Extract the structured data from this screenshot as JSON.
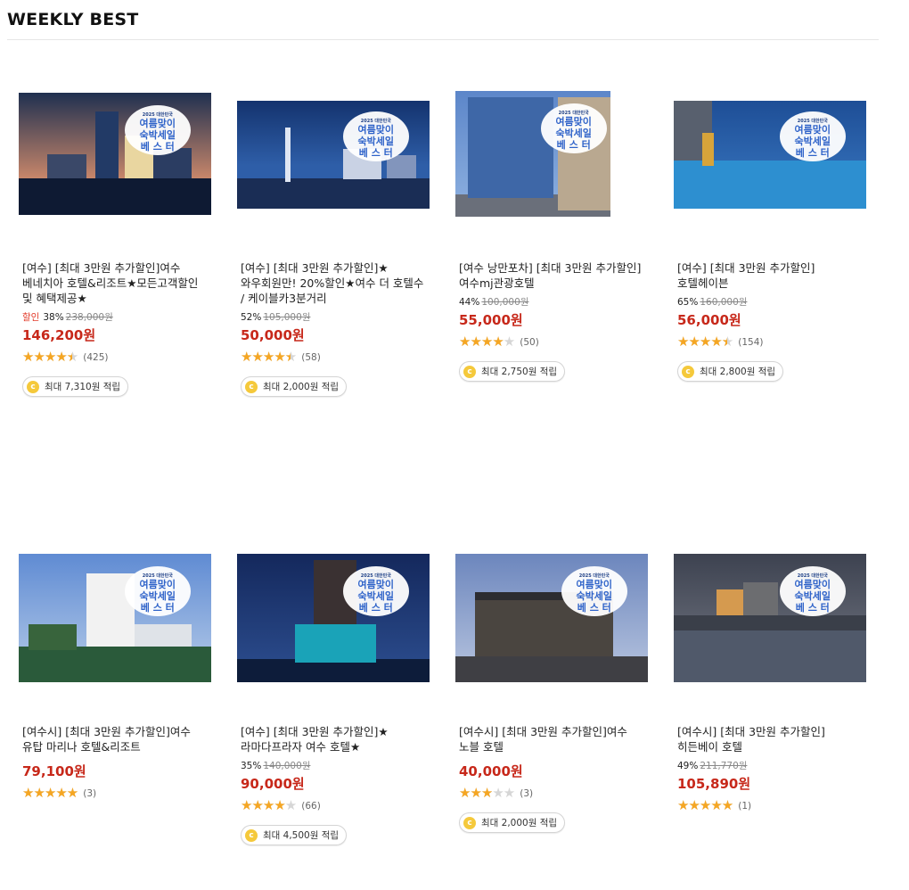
{
  "section": {
    "title": "WEEKLY BEST"
  },
  "badge": {
    "year": "2025 대한민국",
    "line1": "여름맞이",
    "line2": "숙박세일",
    "line3": "베 스 터"
  },
  "points_icon": "coin-icon",
  "colors": {
    "sale": "#e23c2b",
    "price": "#c7281a",
    "star": "#f5a623",
    "badge_text": "#2f63c9"
  },
  "products": [
    {
      "title": "[여수] [최대 3만원 추가할인]여수 베네치아 호텔&리조트★모든고객할인 및 혜택제공★",
      "sale_label": "할인",
      "discount": "38%",
      "original_price": "238,000원",
      "price": "146,200원",
      "rating": 4.5,
      "review_count": "(425)",
      "points": "최대 7,310원 적립"
    },
    {
      "title": "[여수] [최대 3만원 추가할인]★와우회원만! 20%할인★여수 더 호텔수 / 케이블카3분거리",
      "sale_label": "",
      "discount": "52%",
      "original_price": "105,000원",
      "price": "50,000원",
      "rating": 4.5,
      "review_count": "(58)",
      "points": "최대 2,000원 적립"
    },
    {
      "title": "[여수 낭만포차] [최대 3만원 추가할인]여수mj관광호텔",
      "sale_label": "",
      "discount": "44%",
      "original_price": "100,000원",
      "price": "55,000원",
      "rating": 4.0,
      "review_count": "(50)",
      "points": "최대 2,750원 적립"
    },
    {
      "title": "[여수] [최대 3만원 추가할인]호텔헤이븐",
      "sale_label": "",
      "discount": "65%",
      "original_price": "160,000원",
      "price": "56,000원",
      "rating": 4.5,
      "review_count": "(154)",
      "points": "최대 2,800원 적립"
    },
    {
      "title": "[여수시] [최대 3만원 추가할인]여수 유탑 마리나 호텔&리조트",
      "sale_label": "",
      "discount": "",
      "original_price": "",
      "price": "79,100원",
      "rating": 5.0,
      "review_count": "(3)",
      "points": ""
    },
    {
      "title": "[여수] [최대 3만원 추가할인]★라마다프라자 여수 호텔★",
      "sale_label": "",
      "discount": "35%",
      "original_price": "140,000원",
      "price": "90,000원",
      "rating": 4.0,
      "review_count": "(66)",
      "points": "최대 4,500원 적립"
    },
    {
      "title": "[여수시] [최대 3만원 추가할인]여수 노블 호텔",
      "sale_label": "",
      "discount": "",
      "original_price": "",
      "price": "40,000원",
      "rating": 3.0,
      "review_count": "(3)",
      "points": "최대 2,000원 적립"
    },
    {
      "title": "[여수시] [최대 3만원 추가할인]히든베이 호텔",
      "sale_label": "",
      "discount": "49%",
      "original_price": "211,770원",
      "price": "105,890원",
      "rating": 5.0,
      "review_count": "(1)",
      "points": ""
    }
  ]
}
